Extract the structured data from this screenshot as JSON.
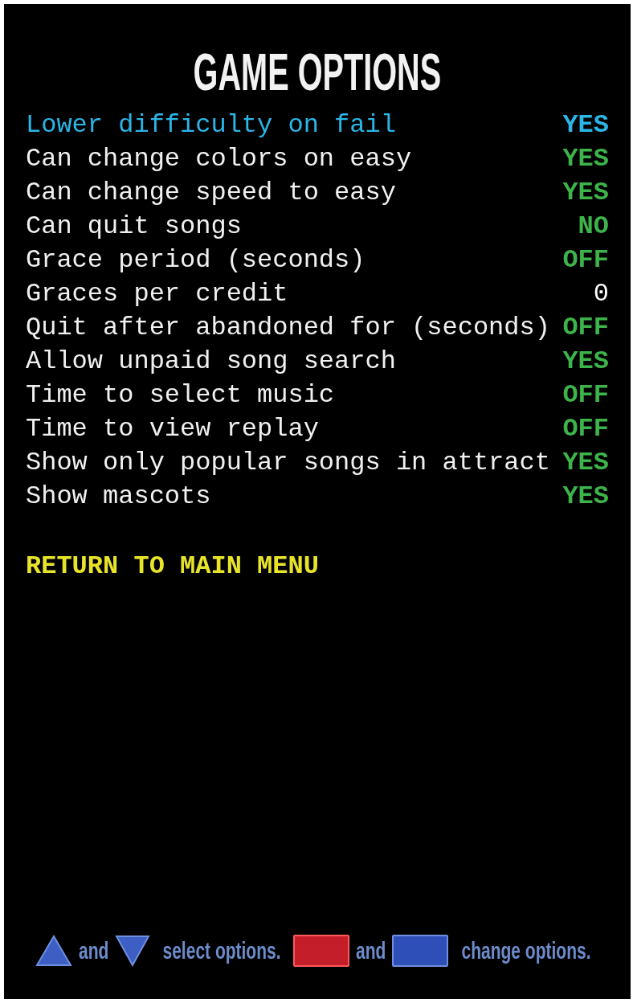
{
  "title": "GAME OPTIONS",
  "options": [
    {
      "label": "Lower difficulty on fail",
      "value": "YES",
      "kind": "toggle",
      "selected": true
    },
    {
      "label": "Can change colors on easy",
      "value": "YES",
      "kind": "toggle",
      "selected": false
    },
    {
      "label": "Can change speed to easy",
      "value": "YES",
      "kind": "toggle",
      "selected": false
    },
    {
      "label": "Can quit songs",
      "value": "NO",
      "kind": "toggle",
      "selected": false
    },
    {
      "label": "Grace period (seconds)",
      "value": "OFF",
      "kind": "toggle",
      "selected": false
    },
    {
      "label": "Graces per credit",
      "value": "0",
      "kind": "number",
      "selected": false
    },
    {
      "label": "Quit after abandoned for (seconds)",
      "value": "OFF",
      "kind": "toggle",
      "selected": false
    },
    {
      "label": "Allow unpaid song search",
      "value": "YES",
      "kind": "toggle",
      "selected": false
    },
    {
      "label": "Time to select music",
      "value": "OFF",
      "kind": "toggle",
      "selected": false
    },
    {
      "label": "Time to view replay",
      "value": "OFF",
      "kind": "toggle",
      "selected": false
    },
    {
      "label": "Show only popular songs in attract",
      "value": "YES",
      "kind": "toggle",
      "selected": false
    },
    {
      "label": "Show mascots",
      "value": "YES",
      "kind": "toggle",
      "selected": false
    }
  ],
  "return_item": {
    "label": "RETURN TO MAIN MENU",
    "selected": false
  },
  "footer": [
    "and",
    "select options.",
    "and",
    "change options."
  ]
}
